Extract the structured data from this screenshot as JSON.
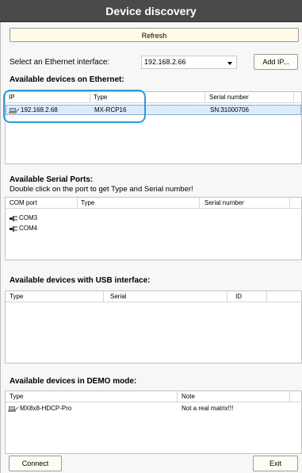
{
  "title": "Device discovery",
  "refresh_label": "Refresh",
  "ethernet": {
    "select_label": "Select an Ethernet interface:",
    "selected_ip": "192.168.2.66",
    "add_ip_label": "Add IP...",
    "section_title": "Available devices on Ethernet:",
    "columns": [
      "IP",
      "Type",
      "Serial number"
    ],
    "rows": [
      {
        "ip": "192.168.2.68",
        "type": "MX-RCP16",
        "serial": "SN:31000706"
      }
    ]
  },
  "serial": {
    "section_title": "Available Serial Ports:",
    "hint": "Double click on the port to get Type and Serial number!",
    "columns": [
      "COM port",
      "Type",
      "Serial number"
    ],
    "rows": [
      {
        "port": "COM3"
      },
      {
        "port": "COM4"
      }
    ]
  },
  "usb": {
    "section_title": "Available devices with USB interface:",
    "columns": [
      "Type",
      "Serial",
      "ID"
    ]
  },
  "demo": {
    "section_title": "Available devices in DEMO mode:",
    "columns": [
      "Type",
      "Note"
    ],
    "rows": [
      {
        "type": "MX8x8-HDCP-Pro",
        "note": "Not a real matrix!!!"
      }
    ]
  },
  "connect_label": "Connect",
  "exit_label": "Exit",
  "icons": {
    "ethernet_device": "network-device-icon",
    "serial_port": "serial-port-icon",
    "demo_device": "network-device-icon"
  },
  "colors": {
    "titlebar": "#4a4a4a",
    "highlight": "#2b9ddb",
    "selection": "#dcebfb"
  }
}
